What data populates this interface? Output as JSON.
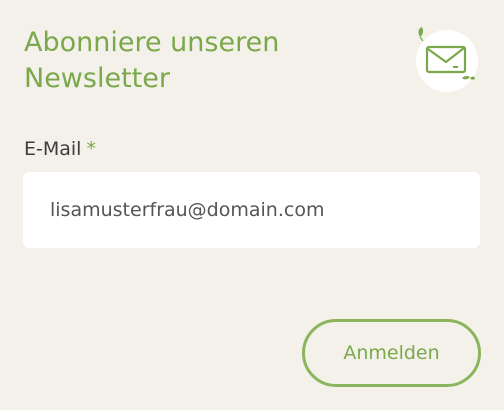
{
  "newsletter": {
    "title": "Abonniere unseren Newsletter",
    "email_label": "E-Mail",
    "required_marker": "*",
    "email_value": "lisamusterfrau@domain.com",
    "submit_label": "Anmelden",
    "icon": "envelope-icon"
  },
  "colors": {
    "background": "#f4f1eb",
    "accent": "#7ba84a",
    "field_background": "#ffffff",
    "label_text": "#3d3d3d"
  }
}
